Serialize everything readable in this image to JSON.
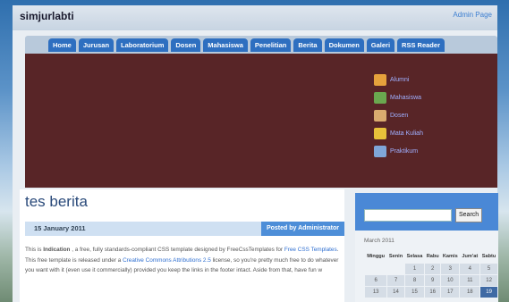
{
  "site": {
    "title": "simjurlabti",
    "admin_link": "Admin Page"
  },
  "nav": [
    "Home",
    "Jurusan",
    "Laboratorium",
    "Dosen",
    "Mahasiswa",
    "Penelitian",
    "Berita",
    "Dokumen",
    "Galeri",
    "RSS Reader"
  ],
  "banner_menu": [
    {
      "label": "Alumni",
      "icon": "alumni-icon",
      "color": "#e6a23c"
    },
    {
      "label": "Mahasiswa",
      "icon": "students-icon",
      "color": "#6aa84f"
    },
    {
      "label": "Dosen",
      "icon": "lecturer-icon",
      "color": "#d9ab6f"
    },
    {
      "label": "Mata Kuliah",
      "icon": "course-icon",
      "color": "#e8c13a"
    },
    {
      "label": "Praktikum",
      "icon": "lab-icon",
      "color": "#7fa6d8"
    }
  ],
  "post": {
    "title": "tes berita",
    "date": "15 January 2011",
    "author": "Posted by Administrator",
    "body": {
      "p1": "This is ",
      "b1": "Indication",
      "p2": " , a free, fully standards-compliant CSS template designed by FreeCssTemplates for ",
      "l1": "Free CSS Templates",
      "p3": ". This free template is released under a ",
      "l2": "Creative Commons Attributions 2.5",
      "p4": " license, so you're pretty much free to do whatever you want with it (even use it commercially) provided you keep the links in the footer intact. Aside from that, have fun w"
    }
  },
  "sidebar": {
    "search_button": "Search",
    "calendar": {
      "caption": "March 2011",
      "days": [
        "Minggu",
        "Senin",
        "Selasa",
        "Rabu",
        "Kamis",
        "Jum'at",
        "Sabtu"
      ],
      "rows": [
        [
          "",
          "",
          "1",
          "2",
          "3",
          "4",
          "5"
        ],
        [
          "6",
          "7",
          "8",
          "9",
          "10",
          "11",
          "12"
        ],
        [
          "13",
          "14",
          "15",
          "16",
          "17",
          "18",
          "19"
        ]
      ],
      "today": "19"
    }
  }
}
